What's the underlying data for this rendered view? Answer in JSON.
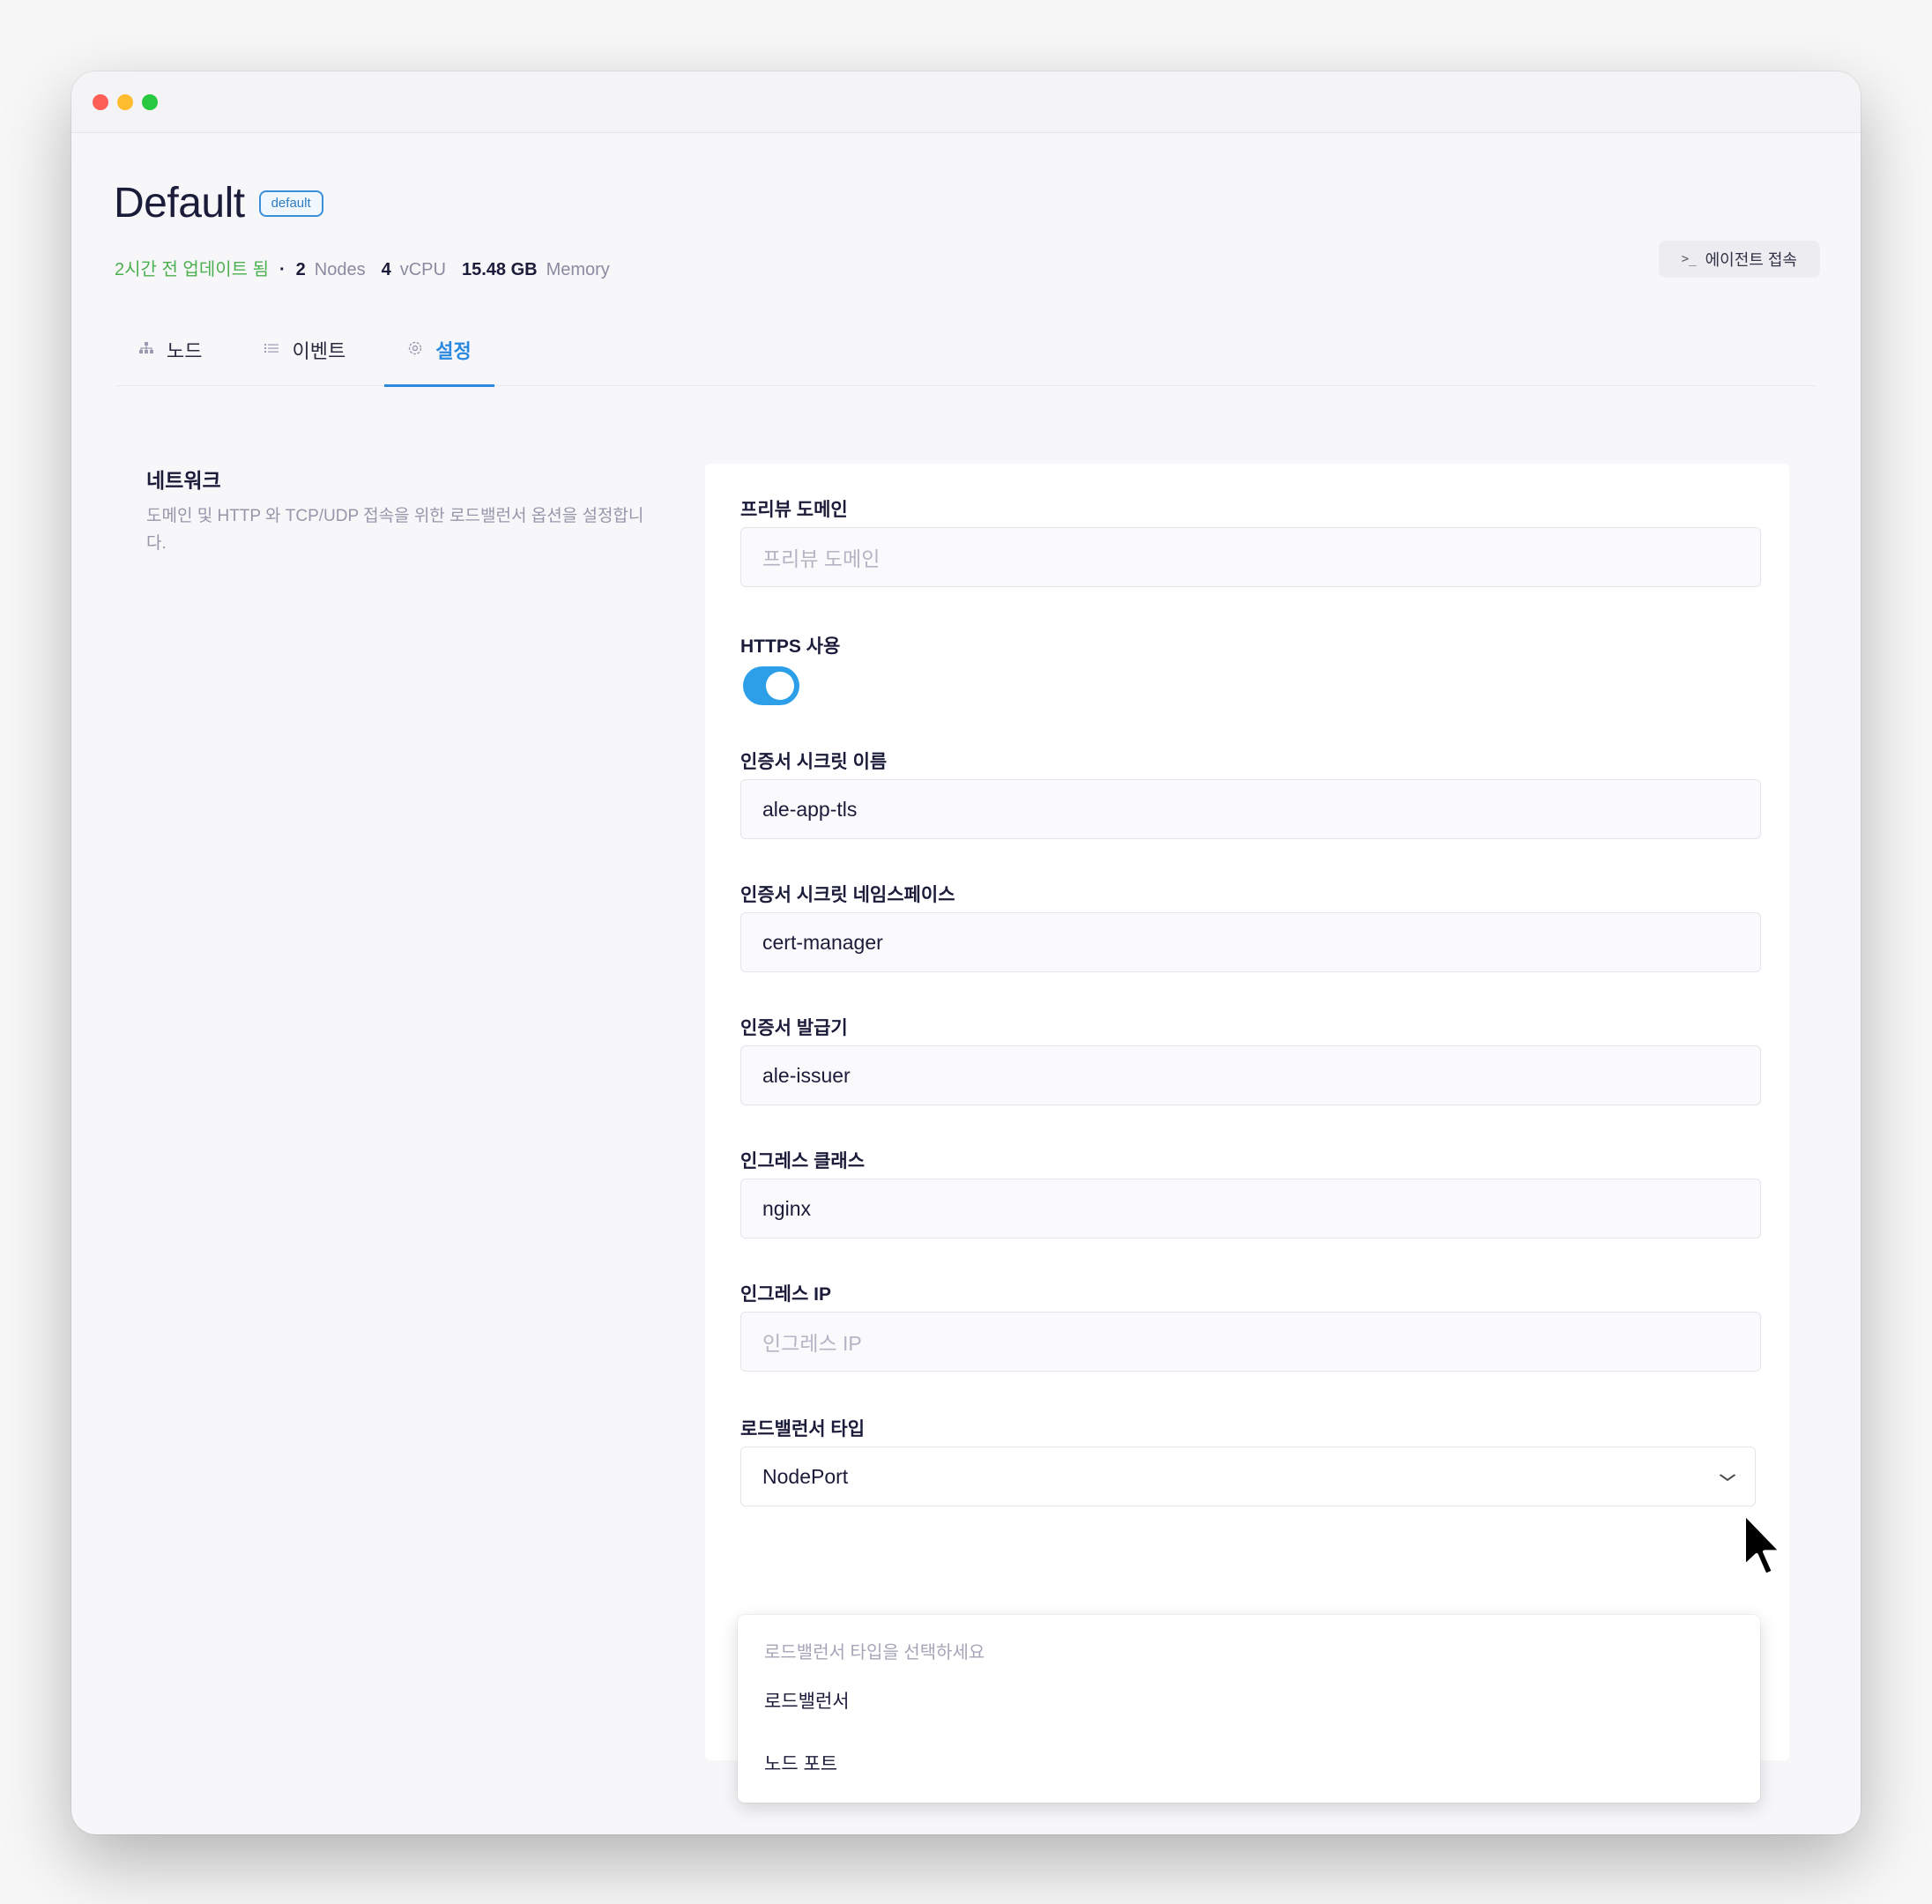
{
  "header": {
    "title": "Default",
    "badge": "default",
    "updated": "2시간 전 업데이트 됨",
    "separator": "·",
    "nodes_count": "2",
    "nodes_unit": "Nodes",
    "vcpu_count": "4",
    "vcpu_unit": "vCPU",
    "memory_value": "15.48 GB",
    "memory_unit": "Memory",
    "agent_button": "에이전트 접속"
  },
  "tabs": [
    {
      "label": "노드",
      "icon": "sitemap-icon",
      "active": false
    },
    {
      "label": "이벤트",
      "icon": "list-icon",
      "active": false
    },
    {
      "label": "설정",
      "icon": "gear-icon",
      "active": true
    }
  ],
  "section": {
    "title": "네트워크",
    "description": "도메인 및 HTTP 와 TCP/UDP 접속을 위한 로드밸런서 옵션을 설정합니다."
  },
  "form": {
    "preview_domain": {
      "label": "프리뷰 도메인",
      "value": "",
      "placeholder": "프리뷰 도메인"
    },
    "https": {
      "label": "HTTPS 사용",
      "enabled": true
    },
    "cert_secret_name": {
      "label": "인증서 시크릿 이름",
      "value": "ale-app-tls"
    },
    "cert_secret_namespace": {
      "label": "인증서 시크릿 네임스페이스",
      "value": "cert-manager"
    },
    "cert_issuer": {
      "label": "인증서 발급기",
      "value": "ale-issuer"
    },
    "ingress_class": {
      "label": "인그레스 클래스",
      "value": "nginx"
    },
    "ingress_ip": {
      "label": "인그레스 IP",
      "value": "",
      "placeholder": "인그레스 IP"
    },
    "lb_type": {
      "label": "로드밸런서 타입",
      "value": "NodePort"
    }
  },
  "dropdown": {
    "placeholder": "로드밸런서 타입을 선택하세요",
    "options": [
      "로드밸런서",
      "노드 포트"
    ]
  },
  "colors": {
    "accent": "#2b8ae0",
    "toggle_on": "#2d9fe8",
    "updated_green": "#4caf50"
  }
}
